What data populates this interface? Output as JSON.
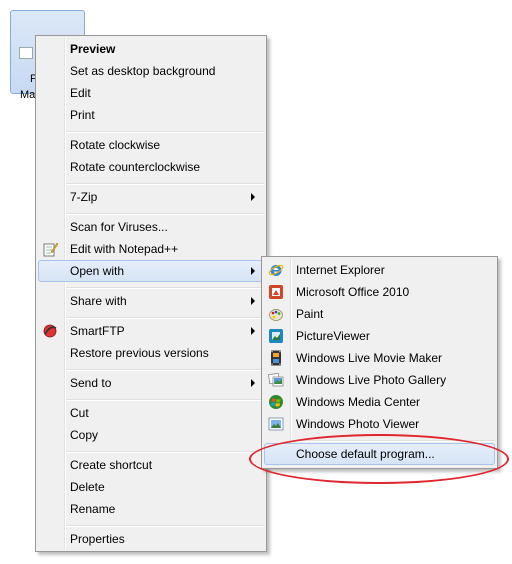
{
  "desktop_icon": {
    "label_line1": "P",
    "label_line2": "Ma"
  },
  "context_menu": {
    "items": [
      {
        "label": "Preview"
      },
      {
        "label": "Set as desktop background"
      },
      {
        "label": "Edit"
      },
      {
        "label": "Print"
      },
      {
        "label": "Rotate clockwise"
      },
      {
        "label": "Rotate counterclockwise"
      },
      {
        "label": "7-Zip"
      },
      {
        "label": "Scan for Viruses..."
      },
      {
        "label": "Edit with Notepad++"
      },
      {
        "label": "Open with"
      },
      {
        "label": "Share with"
      },
      {
        "label": "SmartFTP"
      },
      {
        "label": "Restore previous versions"
      },
      {
        "label": "Send to"
      },
      {
        "label": "Cut"
      },
      {
        "label": "Copy"
      },
      {
        "label": "Create shortcut"
      },
      {
        "label": "Delete"
      },
      {
        "label": "Rename"
      },
      {
        "label": "Properties"
      }
    ]
  },
  "open_with_menu": {
    "items": [
      {
        "label": "Internet Explorer",
        "icon": "internet-explorer-icon"
      },
      {
        "label": "Microsoft Office 2010",
        "icon": "office-icon"
      },
      {
        "label": "Paint",
        "icon": "paint-icon"
      },
      {
        "label": "PictureViewer",
        "icon": "picture-viewer-icon"
      },
      {
        "label": "Windows Live Movie Maker",
        "icon": "movie-maker-icon"
      },
      {
        "label": "Windows Live Photo Gallery",
        "icon": "photo-gallery-icon"
      },
      {
        "label": "Windows Media Center",
        "icon": "media-center-icon"
      },
      {
        "label": "Windows Photo Viewer",
        "icon": "photo-viewer-icon"
      },
      {
        "label": "Choose default program..."
      }
    ]
  },
  "colors": {
    "menu_bg": "#f0f0f0",
    "highlight_border": "#a8c4ea",
    "annotation_red": "#e0262e"
  }
}
